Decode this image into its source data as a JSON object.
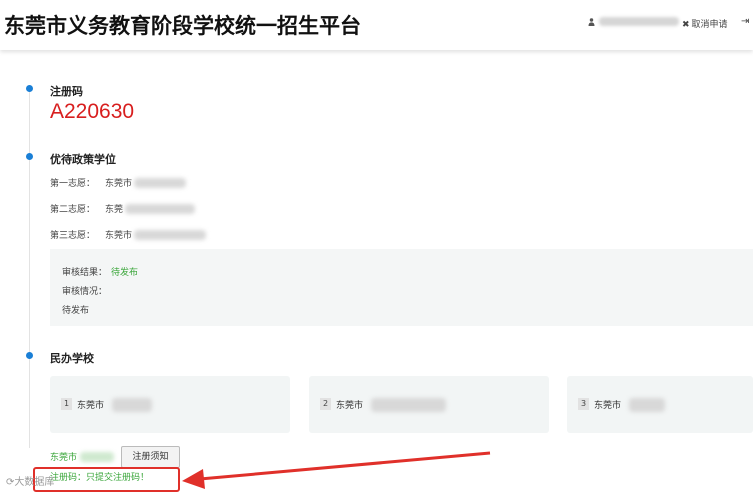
{
  "header": {
    "title": "东莞市义务教育阶段学校统一招生平台",
    "cancel_label": "取消申请"
  },
  "registration": {
    "label": "注册码",
    "code": "A220630"
  },
  "preferential": {
    "label": "优待政策学位",
    "choices": [
      {
        "label": "第一志愿：",
        "school": "东莞市"
      },
      {
        "label": "第二志愿：",
        "school": "东莞"
      },
      {
        "label": "第三志愿：",
        "school": "东莞市"
      }
    ],
    "review": {
      "result_label": "审核结果：",
      "result_value": "待发布",
      "detail_label": "审核情况：",
      "detail_value": "待发布"
    }
  },
  "private_school": {
    "label": "民办学校",
    "cards": [
      {
        "num": "1",
        "name": "东莞市"
      },
      {
        "num": "2",
        "name": "东莞市"
      },
      {
        "num": "3",
        "name": "东莞市"
      }
    ],
    "selected_school": "东莞市",
    "notice_button": "注册须知",
    "reg_status": "注册码：只提交注册码！"
  },
  "watermark": "大数据库",
  "colors": {
    "accent_blue": "#1a7fd6",
    "code_red": "#d81e1e",
    "status_green": "#3aa63a",
    "annotation_red": "#e0302a"
  }
}
